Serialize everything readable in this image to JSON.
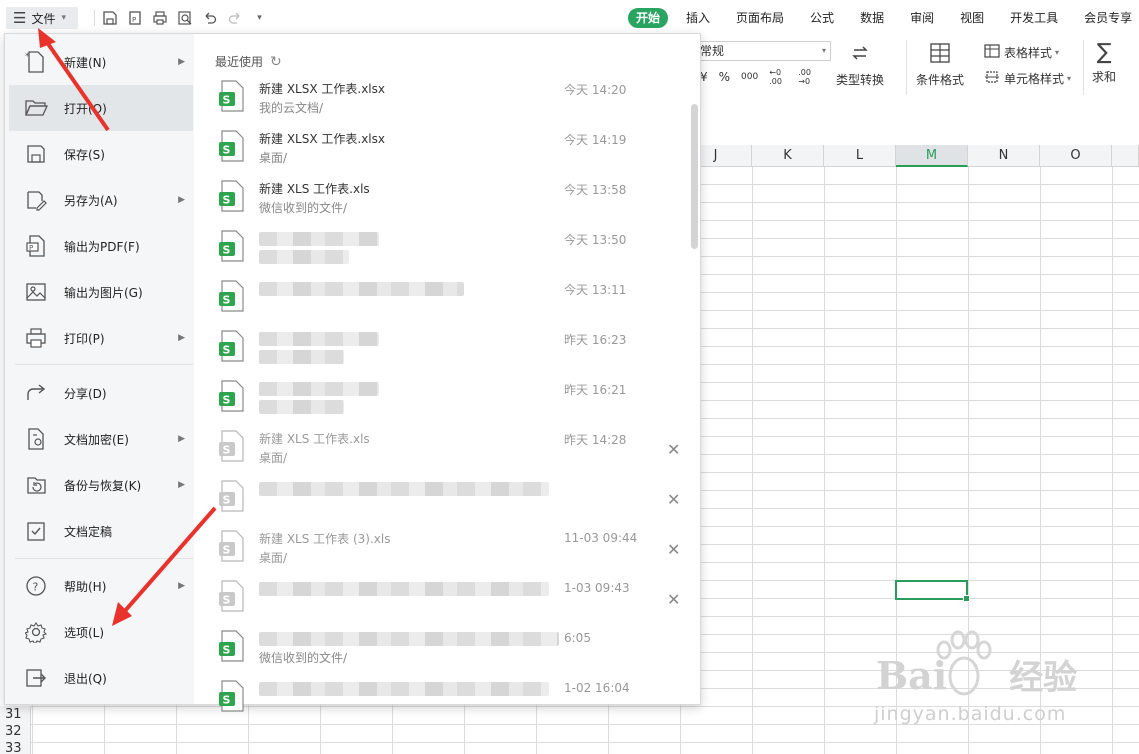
{
  "topbar": {
    "file_label": "文件",
    "tabs": [
      "开始",
      "插入",
      "页面布局",
      "公式",
      "数据",
      "审阅",
      "视图",
      "开发工具",
      "会员专享"
    ],
    "active_tab": "开始"
  },
  "ribbon": {
    "number_format_value": "常规",
    "number_format_buttons": [
      "¥",
      "%",
      "000",
      "←0 .00",
      ".00 →0"
    ],
    "type_convert": "类型转换",
    "conditional_format": "条件格式",
    "table_style": "表格样式",
    "cell_style": "单元格样式",
    "sum": "求和"
  },
  "sheet": {
    "columns": [
      "J",
      "K",
      "L",
      "M",
      "N",
      "O"
    ],
    "selected_column": "M",
    "row_numbers": [
      "31",
      "32",
      "33"
    ]
  },
  "file_menu": {
    "items": [
      {
        "label": "新建(N)",
        "icon": "new-file-icon",
        "has_submenu": true
      },
      {
        "label": "打开(O)",
        "icon": "folder-open-icon",
        "has_submenu": false
      },
      {
        "label": "保存(S)",
        "icon": "save-icon",
        "has_submenu": false
      },
      {
        "label": "另存为(A)",
        "icon": "save-as-icon",
        "has_submenu": true
      },
      {
        "label": "输出为PDF(F)",
        "icon": "pdf-icon",
        "has_submenu": false
      },
      {
        "label": "输出为图片(G)",
        "icon": "image-icon",
        "has_submenu": false
      },
      {
        "label": "打印(P)",
        "icon": "print-icon",
        "has_submenu": true
      },
      {
        "label": "分享(D)",
        "icon": "share-icon",
        "has_submenu": false
      },
      {
        "label": "文档加密(E)",
        "icon": "encrypt-icon",
        "has_submenu": true
      },
      {
        "label": "备份与恢复(K)",
        "icon": "backup-icon",
        "has_submenu": true
      },
      {
        "label": "文档定稿",
        "icon": "finalize-icon",
        "has_submenu": false
      },
      {
        "label": "帮助(H)",
        "icon": "help-icon",
        "has_submenu": true
      },
      {
        "label": "选项(L)",
        "icon": "gear-icon",
        "has_submenu": false
      },
      {
        "label": "退出(Q)",
        "icon": "exit-icon",
        "has_submenu": false
      }
    ],
    "recent_title": "最近使用",
    "recent_files": [
      {
        "name": "新建 XLSX 工作表.xlsx",
        "path": "我的云文档/",
        "time": "今天  14:20",
        "dim": false,
        "closable": false
      },
      {
        "name": "新建 XLSX 工作表.xlsx",
        "path": "桌面/",
        "time": "今天  14:19",
        "dim": false,
        "closable": false
      },
      {
        "name": "新建 XLS 工作表.xls",
        "path": "微信收到的文件/",
        "time": "今天  13:58",
        "dim": false,
        "closable": false
      },
      {
        "name": "",
        "path": "",
        "time": "今天  13:50",
        "dim": false,
        "closable": false
      },
      {
        "name": "",
        "path": "",
        "time": "今天  13:11",
        "dim": false,
        "closable": false
      },
      {
        "name": "",
        "path": "",
        "time": "昨天  16:23",
        "dim": false,
        "closable": false
      },
      {
        "name": "",
        "path": "",
        "time": "昨天  16:21",
        "dim": false,
        "closable": false
      },
      {
        "name": "新建 XLS 工作表.xls",
        "path": "桌面/",
        "time": "昨天  14:28",
        "dim": true,
        "closable": true
      },
      {
        "name": "",
        "path": "",
        "time": "",
        "dim": true,
        "closable": true
      },
      {
        "name": "新建 XLS 工作表 (3).xls",
        "path": "桌面/",
        "time": "11-03 09:44",
        "dim": true,
        "closable": true
      },
      {
        "name": "",
        "path": "",
        "time": "1-03 09:43",
        "dim": true,
        "closable": true
      },
      {
        "name": "",
        "path": "微信收到的文件/",
        "time": "6:05",
        "dim": false,
        "closable": false
      },
      {
        "name": "",
        "path": "",
        "time": "1-02 16:04",
        "dim": false,
        "closable": false
      }
    ]
  },
  "watermark": {
    "brand": "Bai",
    "brand_cn": "经验",
    "url": "jingyan.baidu.com"
  },
  "colors": {
    "accent": "#29a561",
    "arrow": "#e8322b"
  }
}
